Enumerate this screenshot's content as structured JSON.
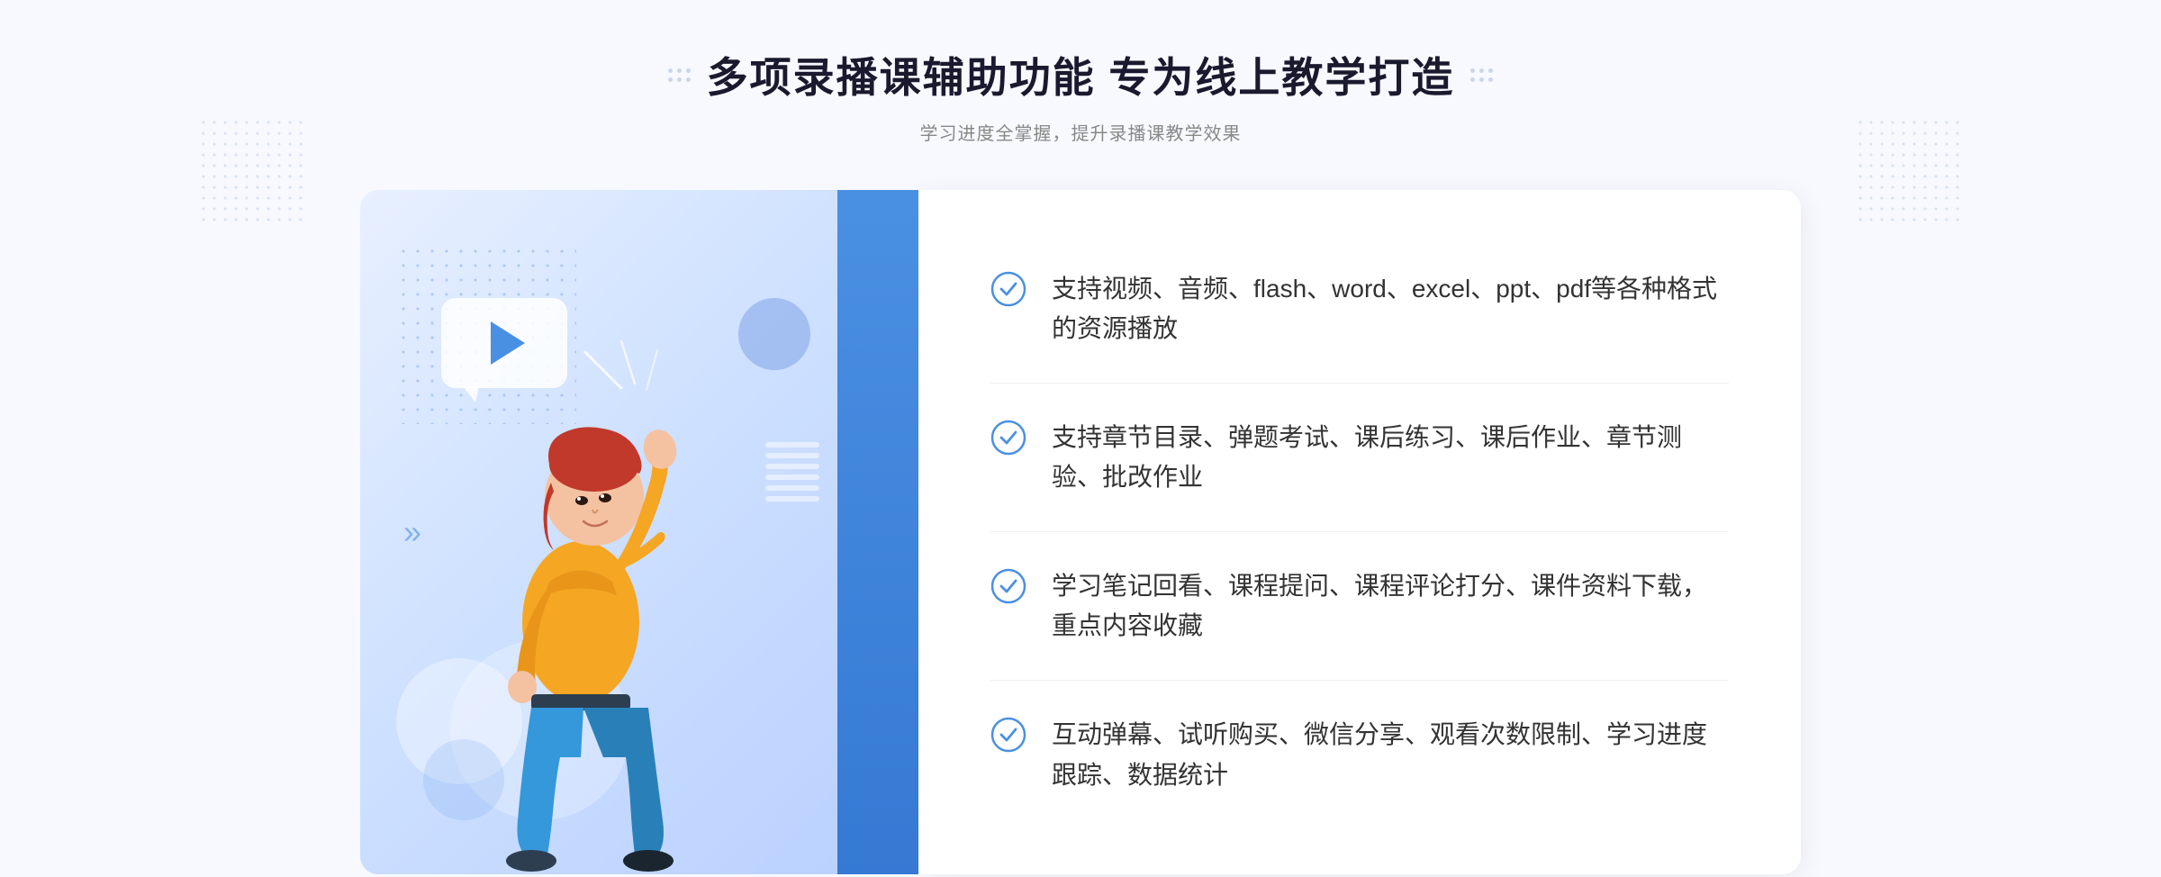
{
  "header": {
    "title": "多项录播课辅助功能 专为线上教学打造",
    "subtitle": "学习进度全掌握，提升录播课教学效果"
  },
  "features": [
    {
      "id": 1,
      "text": "支持视频、音频、flash、word、excel、ppt、pdf等各种格式的资源播放"
    },
    {
      "id": 2,
      "text": "支持章节目录、弹题考试、课后练习、课后作业、章节测验、批改作业"
    },
    {
      "id": 3,
      "text": "学习笔记回看、课程提问、课程评论打分、课件资料下载，重点内容收藏"
    },
    {
      "id": 4,
      "text": "互动弹幕、试听购买、微信分享、观看次数限制、学习进度跟踪、数据统计"
    }
  ],
  "decorations": {
    "chevron_symbol": "»",
    "dots_label": "decorative-dots"
  }
}
